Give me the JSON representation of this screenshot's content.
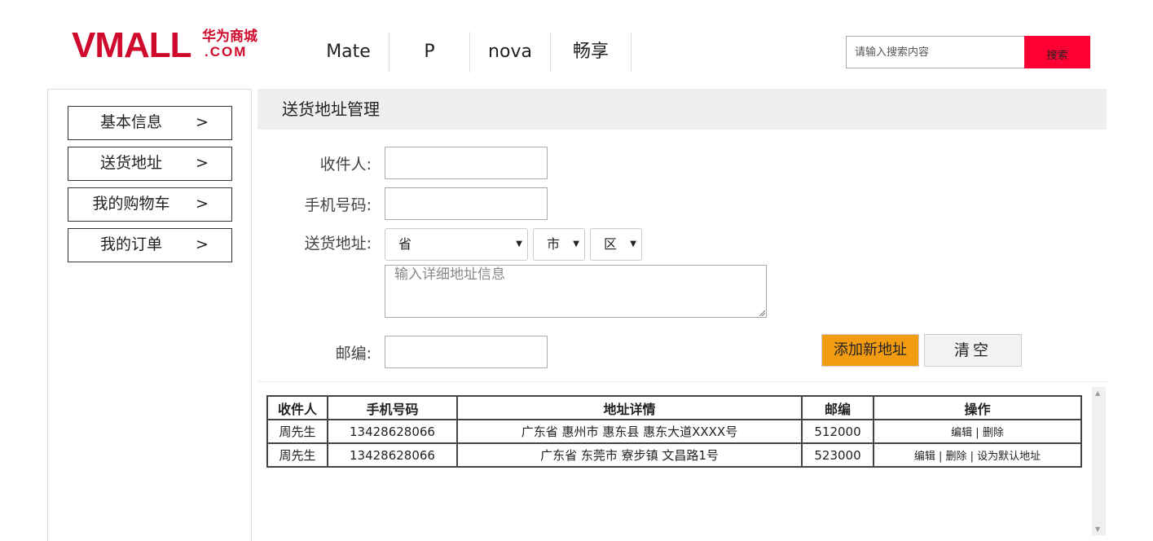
{
  "logo": {
    "brand": "VMALL",
    "cn_name": "华为商城",
    "domain": ".COM",
    "color": "#cf0a2c"
  },
  "nav": {
    "items": [
      "Mate",
      "P",
      "nova",
      "畅享"
    ]
  },
  "search": {
    "placeholder": "请输入搜索内容",
    "button_label": "搜索",
    "button_color": "#ff0033"
  },
  "sidebar": {
    "items": [
      {
        "label": "基本信息",
        "arrow": ">"
      },
      {
        "label": "送货地址",
        "arrow": ">"
      },
      {
        "label": "我的购物车",
        "arrow": ">"
      },
      {
        "label": "我的订单",
        "arrow": ">"
      }
    ]
  },
  "main": {
    "title": "送货地址管理",
    "form": {
      "recipient_label": "收件人:",
      "phone_label": "手机号码:",
      "address_label": "送货地址:",
      "province": "省",
      "city": "市",
      "district": "区",
      "detail_placeholder": "输入详细地址信息",
      "zip_label": "邮编:",
      "add_button": "添加新地址",
      "clear_button": "清空"
    },
    "table": {
      "headers": [
        "收件人",
        "手机号码",
        "地址详情",
        "邮编",
        "操作"
      ],
      "rows": [
        {
          "name": "周先生",
          "phone": "13428628066",
          "address": "广东省 惠州市 惠东县 惠东大道XXXX号",
          "zip": "512000",
          "edit": "编辑",
          "delete": "删除",
          "set_default": ""
        },
        {
          "name": "周先生",
          "phone": "13428628066",
          "address": "广东省 东莞市 寮步镇 文昌路1号",
          "zip": "523000",
          "edit": "编辑",
          "delete": "删除",
          "set_default": "设为默认地址"
        }
      ]
    }
  }
}
